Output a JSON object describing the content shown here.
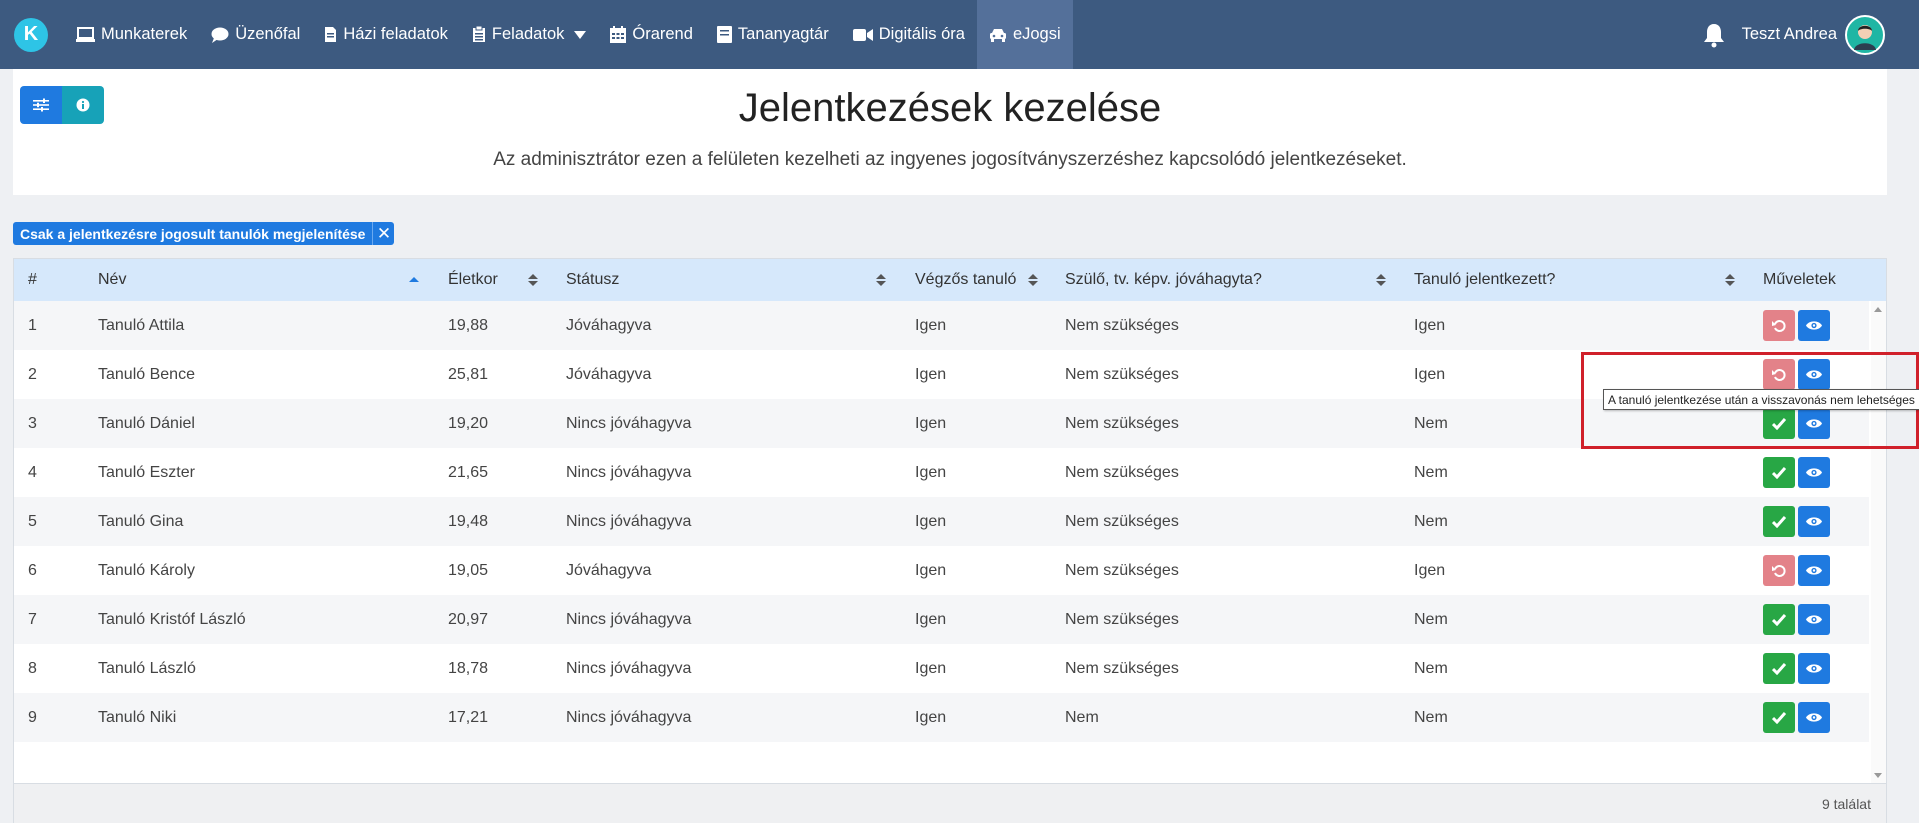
{
  "nav": {
    "logo_letter": "K",
    "items": [
      {
        "label": "Munkaterek",
        "icon": "laptop-icon"
      },
      {
        "label": "Üzenőfal",
        "icon": "chat-bubble-icon"
      },
      {
        "label": "Házi feladatok",
        "icon": "document-icon"
      },
      {
        "label": "Feladatok",
        "icon": "clipboard-icon"
      },
      {
        "label": "Órarend",
        "icon": "calendar-icon"
      },
      {
        "label": "Tananyagtár",
        "icon": "book-icon"
      },
      {
        "label": "Digitális óra",
        "icon": "video-camera-icon"
      },
      {
        "label": "eJogsi",
        "icon": "car-icon"
      }
    ],
    "user_name": "Teszt Andrea"
  },
  "header": {
    "title": "Jelentkezések kezelése",
    "subtitle": "Az adminisztrátor ezen a felületen kezelheti az ingyenes jogosítványszerzéshez kapcsolódó jelentkezéseket."
  },
  "filter": {
    "chip_label": "Csak a jelentkezésre jogosult tanulók megjelenítése",
    "close_glyph": "✕"
  },
  "table": {
    "columns": {
      "index": "#",
      "name": "Név",
      "age": "Életkor",
      "status": "Státusz",
      "final_year": "Végzős tanuló",
      "parent_approved": "Szülő, tv. képv. jóváhagyta?",
      "applied": "Tanuló jelentkezett?",
      "actions": "Műveletek"
    },
    "rows": [
      {
        "index": "1",
        "name": "Tanuló Attila",
        "age": "19,88",
        "status": "Jóváhagyva",
        "final_year": "Igen",
        "parent_approved": "Nem szükséges",
        "applied": "Igen",
        "action": "revert"
      },
      {
        "index": "2",
        "name": "Tanuló Bence",
        "age": "25,81",
        "status": "Jóváhagyva",
        "final_year": "Igen",
        "parent_approved": "Nem szükséges",
        "applied": "Igen",
        "action": "revert"
      },
      {
        "index": "3",
        "name": "Tanuló Dániel",
        "age": "19,20",
        "status": "Nincs jóváhagyva",
        "final_year": "Igen",
        "parent_approved": "Nem szükséges",
        "applied": "Nem",
        "action": "approve"
      },
      {
        "index": "4",
        "name": "Tanuló Eszter",
        "age": "21,65",
        "status": "Nincs jóváhagyva",
        "final_year": "Igen",
        "parent_approved": "Nem szükséges",
        "applied": "Nem",
        "action": "approve"
      },
      {
        "index": "5",
        "name": "Tanuló Gina",
        "age": "19,48",
        "status": "Nincs jóváhagyva",
        "final_year": "Igen",
        "parent_approved": "Nem szükséges",
        "applied": "Nem",
        "action": "approve"
      },
      {
        "index": "6",
        "name": "Tanuló Károly",
        "age": "19,05",
        "status": "Jóváhagyva",
        "final_year": "Igen",
        "parent_approved": "Nem szükséges",
        "applied": "Igen",
        "action": "revert"
      },
      {
        "index": "7",
        "name": "Tanuló Kristóf László",
        "age": "20,97",
        "status": "Nincs jóváhagyva",
        "final_year": "Igen",
        "parent_approved": "Nem szükséges",
        "applied": "Nem",
        "action": "approve"
      },
      {
        "index": "8",
        "name": "Tanuló László",
        "age": "18,78",
        "status": "Nincs jóváhagyva",
        "final_year": "Igen",
        "parent_approved": "Nem szükséges",
        "applied": "Nem",
        "action": "approve"
      },
      {
        "index": "9",
        "name": "Tanuló Niki",
        "age": "17,21",
        "status": "Nincs jóváhagyva",
        "final_year": "Igen",
        "parent_approved": "Nem",
        "applied": "Nem",
        "action": "approve"
      }
    ],
    "result_count": "9 találat"
  },
  "tooltip": {
    "text": "A tanuló jelentkezése után a visszavonás nem lehetséges"
  },
  "colors": {
    "navbar": "#3d5a80",
    "primary": "#1f7ae0",
    "success": "#28a745",
    "revert": "#e38289",
    "highlight": "#d0202a"
  }
}
